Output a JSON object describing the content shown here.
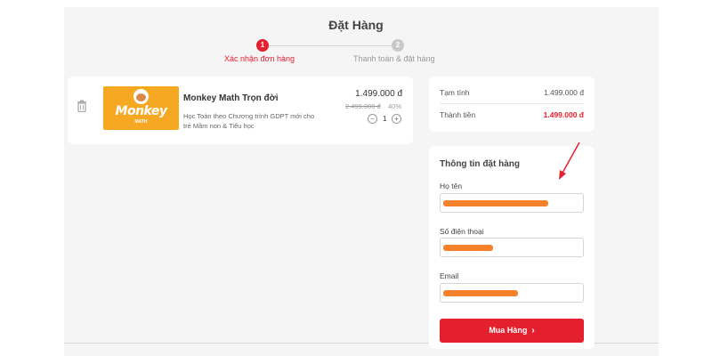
{
  "header": {
    "title": "Đặt Hàng"
  },
  "steps": [
    {
      "number": "1",
      "label": "Xác nhận đơn hàng",
      "active": true
    },
    {
      "number": "2",
      "label": "Thanh toán & đặt hàng",
      "active": false
    }
  ],
  "product": {
    "image_brand": "Monkey",
    "image_sub": "MATH",
    "name": "Monkey Math Trọn đời",
    "description": "Học Toán theo Chương trình GDPT mới cho trẻ Mầm non & Tiểu học",
    "price": "1.499.000 đ",
    "old_price": "2.499.000 đ",
    "discount": "40%",
    "quantity": "1",
    "minus_icon": "minus-icon",
    "plus_icon": "plus-icon",
    "delete_icon": "trash-icon"
  },
  "summary": {
    "subtotal_label": "Tạm tính",
    "subtotal_value": "1.499.000 đ",
    "total_label": "Thành tiền",
    "total_value": "1.499.000 đ"
  },
  "order_form": {
    "title": "Thông tin đặt hàng",
    "name_label": "Họ tên",
    "phone_label": "Số điện thoại",
    "email_label": "Email",
    "submit_label": "Mua Hàng",
    "submit_icon": "chevron-right-icon"
  },
  "colors": {
    "accent": "#e5202e",
    "redaction": "#f5822b",
    "thumbnail": "#f7a823",
    "inactive_step": "#c8c8c8"
  }
}
